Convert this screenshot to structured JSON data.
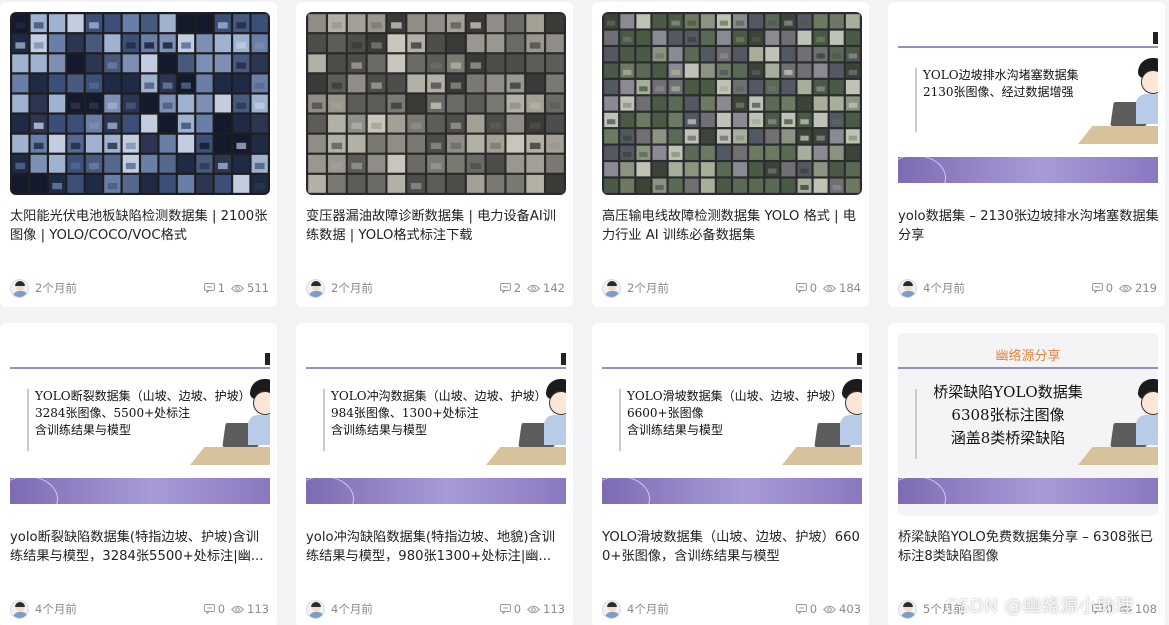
{
  "cards": [
    {
      "title": "太阳能光伏电池板缺陷检测数据集 | 2100张图像 | YOLO/COCO/VOC格式",
      "time": "2个月前",
      "comments": "1",
      "views": "511",
      "thumb": "mosaic-dark"
    },
    {
      "title": "变压器漏油故障诊断数据集 | 电力设备AI训练数据 | YOLO格式标注下载",
      "time": "2个月前",
      "comments": "2",
      "views": "142",
      "thumb": "mosaic-gray"
    },
    {
      "title": "高压输电线故障检测数据集 YOLO 格式 | 电力行业 AI 训练必备数据集",
      "time": "2个月前",
      "comments": "0",
      "views": "184",
      "thumb": "mosaic-green"
    },
    {
      "title": "yolo数据集 – 2130张边坡排水沟堵塞数据集分享",
      "time": "4个月前",
      "comments": "0",
      "views": "219",
      "thumb": "slide",
      "slide_lines": [
        "YOLO边坡排水沟堵塞数据集",
        "2130张图像、经过数据增强"
      ]
    },
    {
      "title": "yolo断裂缺陷数据集(特指边坡、护坡)含训练结果与模型，3284张5500+处标注|幽...",
      "time": "4个月前",
      "comments": "0",
      "views": "113",
      "thumb": "slide",
      "slide_lines": [
        "YOLO断裂数据集（山坡、边坡、护坡）",
        "3284张图像、5500+处标注",
        "含训练结果与模型"
      ]
    },
    {
      "title": "yolo冲沟缺陷数据集(特指边坡、地貌)含训练结果与模型，980张1300+处标注|幽...",
      "time": "4个月前",
      "comments": "0",
      "views": "113",
      "thumb": "slide",
      "slide_lines": [
        "YOLO冲沟数据集（山坡、边坡、护坡）",
        "984张图像、1300+处标注",
        "含训练结果与模型"
      ]
    },
    {
      "title": "YOLO滑坡数据集（山坡、边坡、护坡）6600+张图像，含训练结果与模型",
      "time": "4个月前",
      "comments": "0",
      "views": "403",
      "thumb": "slide",
      "slide_lines": [
        "YOLO滑坡数据集（山坡、边坡、护坡）",
        "6600+张图像",
        "含训练结果与模型"
      ]
    },
    {
      "title": "桥梁缺陷YOLO免费数据集分享 – 6308张已标注8类缺陷图像",
      "time": "5个月前",
      "comments": "0",
      "views": "108",
      "thumb": "slide-big",
      "banner": "幽络源分享",
      "slide_lines": [
        "桥梁缺陷YOLO数据集",
        "6308张标注图像",
        "涵盖8类桥梁缺陷"
      ]
    }
  ],
  "watermark": "CSDN @幽络源小助理",
  "colors": {
    "accent": "#9b8bc4",
    "banner": "#e0863c",
    "meta": "#8a8a8f"
  }
}
